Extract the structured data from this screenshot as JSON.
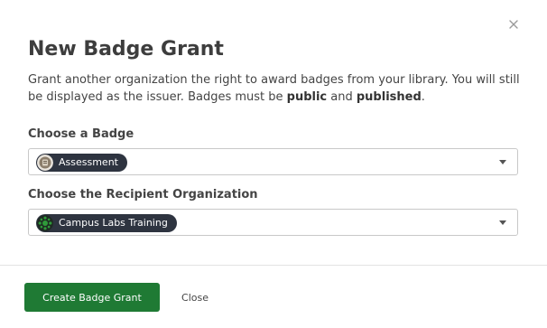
{
  "dialog": {
    "title": "New Badge Grant",
    "description_prefix": "Grant another organization the right to award badges from your library. You will still be displayed as the issuer. Badges must be ",
    "description_public": "public",
    "description_and": " and ",
    "description_published": "published",
    "description_suffix": ".",
    "close_icon": "close-icon"
  },
  "badge_field": {
    "label": "Choose a Badge",
    "selected": "Assessment",
    "icon": "badge-thumbnail-icon"
  },
  "recipient_field": {
    "label": "Choose the Recipient Organization",
    "selected": "Campus Labs Training",
    "icon": "organization-logo-icon"
  },
  "footer": {
    "primary_label": "Create Badge Grant",
    "secondary_label": "Close"
  },
  "colors": {
    "primary": "#1f7a34",
    "chip": "#2e3440",
    "org_logo": "#2f9a3a"
  }
}
